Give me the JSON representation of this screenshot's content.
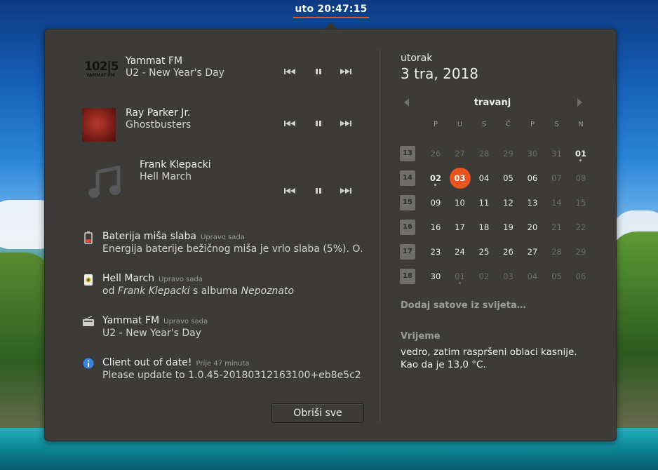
{
  "topbar": {
    "clock": "uto 20:47:15"
  },
  "media": [
    {
      "art": "yammat-fm-logo",
      "logo_num": "102|5",
      "logo_sub": "YAMMAT FM",
      "title": "Yammat FM",
      "subtitle": "U2 - New Year's Day"
    },
    {
      "art": "album-cover",
      "title": "Ray Parker Jr.",
      "subtitle": "Ghostbusters"
    },
    {
      "art": "music-note-icon",
      "title": "Frank Klepacki",
      "subtitle": "Hell March"
    }
  ],
  "notifications": [
    {
      "icon": "battery-warning-icon",
      "title": "Baterija miša slaba",
      "time": "Upravo sada",
      "body": "Energija baterije bežičnog miša je vrlo slaba (5%). O…"
    },
    {
      "icon": "media-player-icon",
      "title": "Hell March",
      "time": "Upravo sada",
      "body_prefix": "od ",
      "body_artist": "Frank Klepacki",
      "body_mid": " s albuma ",
      "body_album": "Nepoznato"
    },
    {
      "icon": "radio-icon",
      "title": "Yammat FM",
      "time": "Upravo sada",
      "body": "U2 - New Year's Day"
    },
    {
      "icon": "info-icon",
      "title": "Client out of date!",
      "time": "Prije 47 minuta",
      "body": "Please update to 1.0.45-20180312163100+eb8e5c25…"
    }
  ],
  "clear_all_label": "Obriši sve",
  "date": {
    "weekday": "utorak",
    "full": "3 tra, 2018"
  },
  "calendar": {
    "month": "travanj",
    "day_headers": [
      "P",
      "U",
      "S",
      "Č",
      "P",
      "S",
      "N"
    ],
    "weeks": [
      {
        "num": "13",
        "days": [
          {
            "d": "26",
            "other": true
          },
          {
            "d": "27",
            "other": true
          },
          {
            "d": "28",
            "other": true
          },
          {
            "d": "29",
            "other": true
          },
          {
            "d": "30",
            "other": true
          },
          {
            "d": "31",
            "other": true
          },
          {
            "d": "01",
            "bold": true,
            "dot": true
          }
        ]
      },
      {
        "num": "14",
        "days": [
          {
            "d": "02",
            "bold": true,
            "dot": true
          },
          {
            "d": "03",
            "today": true
          },
          {
            "d": "04"
          },
          {
            "d": "05"
          },
          {
            "d": "06"
          },
          {
            "d": "07",
            "other": true
          },
          {
            "d": "08",
            "other": true
          }
        ]
      },
      {
        "num": "15",
        "days": [
          {
            "d": "09"
          },
          {
            "d": "10"
          },
          {
            "d": "11"
          },
          {
            "d": "12"
          },
          {
            "d": "13"
          },
          {
            "d": "14",
            "other": true
          },
          {
            "d": "15",
            "other": true
          }
        ]
      },
      {
        "num": "16",
        "days": [
          {
            "d": "16"
          },
          {
            "d": "17"
          },
          {
            "d": "18"
          },
          {
            "d": "19"
          },
          {
            "d": "20"
          },
          {
            "d": "21",
            "other": true
          },
          {
            "d": "22",
            "other": true
          }
        ]
      },
      {
        "num": "17",
        "days": [
          {
            "d": "23"
          },
          {
            "d": "24"
          },
          {
            "d": "25"
          },
          {
            "d": "26"
          },
          {
            "d": "27"
          },
          {
            "d": "28",
            "other": true
          },
          {
            "d": "29",
            "other": true
          }
        ]
      },
      {
        "num": "18",
        "days": [
          {
            "d": "30"
          },
          {
            "d": "01",
            "other": true,
            "dot": true
          },
          {
            "d": "02",
            "other": true
          },
          {
            "d": "03",
            "other": true
          },
          {
            "d": "04",
            "other": true
          },
          {
            "d": "05",
            "other": true
          },
          {
            "d": "06",
            "other": true
          }
        ]
      }
    ]
  },
  "world_clocks_label": "Dodaj satove iz svijeta…",
  "weather": {
    "title": "Vrijeme",
    "line1": "vedro, zatim raspršeni oblaci kasnije.",
    "line2": "Kao da je 13,0 °C."
  },
  "colors": {
    "accent": "#e95420",
    "panel_bg": "#3c3b37"
  }
}
